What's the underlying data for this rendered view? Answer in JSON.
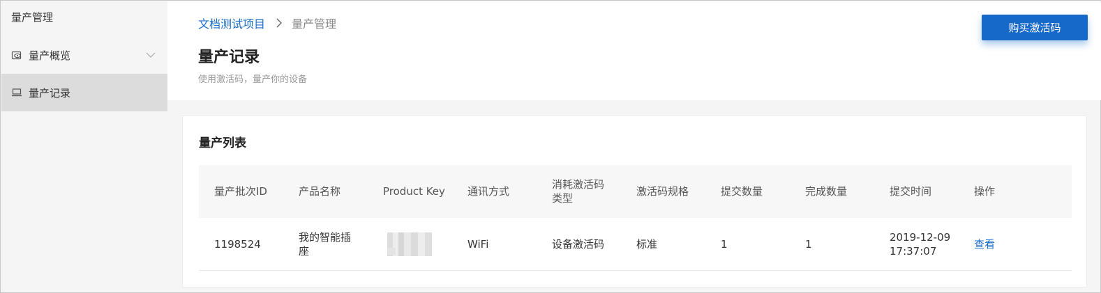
{
  "sidebar": {
    "title": "量产管理",
    "items": [
      {
        "label": "量产概览",
        "icon": "eye-badge-icon"
      },
      {
        "label": "量产记录",
        "icon": "laptop-icon"
      }
    ]
  },
  "breadcrumb": {
    "project": "文档测试项目",
    "current": "量产管理"
  },
  "page": {
    "title": "量产记录",
    "subtitle": "使用激活码，量产你的设备"
  },
  "toolbar": {
    "buy_label": "购买激活码"
  },
  "card": {
    "title": "量产列表"
  },
  "table": {
    "headers": [
      "量产批次ID",
      "产品名称",
      "Product Key",
      "通讯方式",
      "消耗激活码类型",
      "激活码规格",
      "提交数量",
      "完成数量",
      "提交时间",
      "操作"
    ],
    "rows": [
      {
        "batch_id": "1198524",
        "product_name": "我的智能插座",
        "comm": "WiFi",
        "code_type": "设备激活码",
        "spec": "标准",
        "submitted": "1",
        "completed": "1",
        "time": "2019-12-09 17:37:07",
        "action": "查看"
      }
    ]
  },
  "colors": {
    "accent": "#1769c9",
    "link": "#1a6ec9",
    "selected_bg": "#dcdcdc"
  }
}
